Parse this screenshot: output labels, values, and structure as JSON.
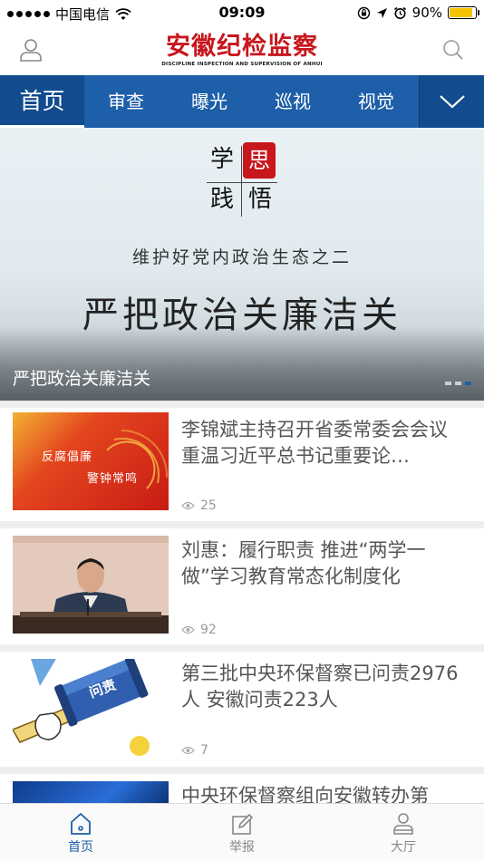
{
  "status_bar": {
    "carrier": "中国电信",
    "time": "09:09",
    "battery": "90%",
    "battery_level": 0.9
  },
  "header": {
    "title": "安徽纪检监察",
    "subtitle": "DISCIPLINE INSPECTION AND SUPERVISION OF ANHUI",
    "brand_color": "#c8161d"
  },
  "channels": {
    "tabs": [
      {
        "label": "首页",
        "active": true
      },
      {
        "label": "审查"
      },
      {
        "label": "曝光"
      },
      {
        "label": "巡视"
      },
      {
        "label": "视觉"
      }
    ],
    "accent": "#1d5fa8"
  },
  "banner": {
    "stamp_chars": [
      "学",
      "思",
      "践",
      "悟"
    ],
    "subheading": "维护好党内政治生态之二",
    "heading": "严把政治关廉洁关",
    "caption": "严把政治关廉洁关",
    "slide_count": 3,
    "active_slide": 3
  },
  "news": [
    {
      "title": "李锦斌主持召开省委常委会会议 重温习近平总书记重要论…",
      "views": "25",
      "thumb_text": [
        "反腐倡廉",
        "警钟常鸣"
      ]
    },
    {
      "title": "刘惠：履行职责 推进“两学一做”学习教育常态化制度化",
      "views": "92"
    },
    {
      "title": "第三批中央环保督察已问责2976人 安徽问责223人",
      "views": "7",
      "thumb_text": [
        "问责"
      ]
    },
    {
      "title": "中央环保督察组向安徽转办第"
    }
  ],
  "bottom_nav": [
    {
      "label": "首页",
      "icon": "home-icon",
      "active": true
    },
    {
      "label": "举报",
      "icon": "edit-icon"
    },
    {
      "label": "大厅",
      "icon": "user-icon"
    }
  ]
}
